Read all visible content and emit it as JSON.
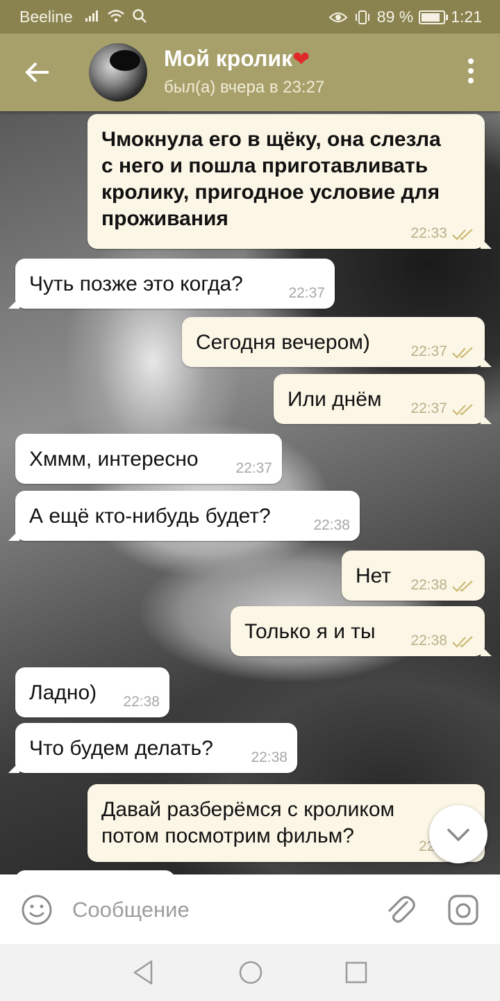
{
  "status_bar": {
    "carrier": "Beeline",
    "battery_percent": "89 %",
    "time": "1:21"
  },
  "header": {
    "contact_name": "Мой кролик",
    "heart_emoji": "❤",
    "last_seen": "был(а) вчера в 23:27"
  },
  "messages": [
    {
      "direction": "out",
      "lines": [
        "Чмокнула его в щёку, она слезла",
        "с него и пошла приготавливать",
        "кролику, пригодное условие для",
        "проживания"
      ],
      "time": "22:33",
      "read": true
    },
    {
      "direction": "in",
      "lines": [
        "Чуть позже это когда?"
      ],
      "time": "22:37"
    },
    {
      "direction": "out",
      "lines": [
        "Сегодня вечером)"
      ],
      "time": "22:37",
      "read": true
    },
    {
      "direction": "out",
      "lines": [
        "Или днём"
      ],
      "time": "22:37",
      "read": true
    },
    {
      "direction": "in",
      "lines": [
        "Хммм, интересно"
      ],
      "time": "22:37"
    },
    {
      "direction": "in",
      "lines": [
        "А ещё кто-нибудь будет?"
      ],
      "time": "22:38"
    },
    {
      "direction": "out",
      "lines": [
        "Нет"
      ],
      "time": "22:38",
      "read": true
    },
    {
      "direction": "out",
      "lines": [
        "Только я и ты"
      ],
      "time": "22:38",
      "read": true
    },
    {
      "direction": "in",
      "lines": [
        "Ладно)"
      ],
      "time": "22:38"
    },
    {
      "direction": "in",
      "lines": [
        "Что будем делать?"
      ],
      "time": "22:38"
    },
    {
      "direction": "out",
      "lines": [
        "Давай разберёмся с кроликом",
        "потом посмотрим фильм?"
      ],
      "time": "22:3",
      "read": true
    }
  ],
  "input": {
    "placeholder": "Сообщение"
  },
  "icons": {
    "back": "arrow-left-icon",
    "menu": "more-vertical-icon",
    "emoji": "smiley-icon",
    "attach": "paperclip-icon",
    "camera": "camera-icon",
    "scroll_down": "chevron-down-icon"
  },
  "colors": {
    "header": "#a7a06a",
    "status_bar": "#8a8350",
    "outgoing_bubble": "#fbf6e6",
    "incoming_bubble": "#ffffff",
    "read_ticks": "#c8b56a",
    "heart": "#e02828"
  }
}
